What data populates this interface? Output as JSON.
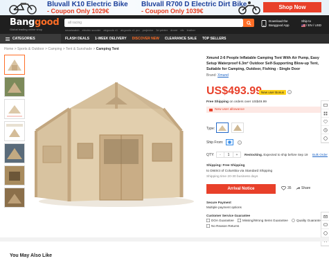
{
  "banner": {
    "left_title": "Bluvall K10 Electric Bike",
    "left_coupon": "- Coupon Only 1029€",
    "right_title": "Bluvall R700 D Electric Dirt Bike",
    "right_coupon": "- Coupon Only 1039€",
    "cta": "Shop Now"
  },
  "header": {
    "logo_main": "Bang",
    "logo_accent": "good",
    "tagline": "Global leading online shop",
    "search_value": "all racing",
    "hot_searches": [
      "smartwatch",
      "electric scooter",
      "airgoods x1",
      "airgoods x1 pro",
      "projector",
      "3d printer",
      "drone",
      "nfc",
      "leather"
    ],
    "app_line1": "Download the",
    "app_line2": "Banggood App",
    "ship_line1": "Ship to",
    "ship_line2": "/ EN / USD"
  },
  "nav": {
    "categories": "CATEGORIES",
    "items": [
      "FLASH DEALS",
      "1-WEEK DELIVERY",
      "DISCOVER NEW",
      "CLEARANCE SALE",
      "TOP SELLERS"
    ]
  },
  "breadcrumb": {
    "path": "Home > Sports & Outdoor > Camping > Tent & Sunshade > ",
    "current": "Camping Tent"
  },
  "product": {
    "title": "Xmund 2-6 People Inflatable Camping Tent With Air Pump, Easy Setup Waterproof 6.3m² Outdoor Self-Supporting Blow-up Tent, Suitable for Camping, Outdoor, Fishing - Single Door",
    "brand_label": "Brand: ",
    "brand": "Xmund",
    "price": "US$493.99",
    "bonus_badge": "New user Bonus",
    "free_ship_bold": "Free Shipping",
    "free_ship_rest": " on orders over US$49.99",
    "allowance": "New user allowance",
    "type_label": "Type:",
    "ship_from_label": "Ship From:",
    "qty_label": "QTY:",
    "qty_minus": "-",
    "qty_value": "1",
    "qty_plus": "+",
    "restock_bold": "Restocking.",
    "restock_rest": " Expected to ship before Sep 19",
    "bulk": "Bulk Order",
    "ship_title": "Shipping: Free Shipping",
    "ship_to": "to District of Columbia via Standard Shipping",
    "ship_time": "Shipping time 20-30 business days",
    "notice_btn": "Arrival Notice",
    "wish_count": "35",
    "share": "Share",
    "secure_title": "Secure Payment",
    "secure_sub": "Multiple payment options",
    "service_title": "Customer Service Guarantee",
    "guarantees": [
      "DOA Guarantee",
      "Missing/Wrong Items Guarantee",
      "Quality Guarantee"
    ],
    "no_return": "No Reason Returns"
  },
  "bottom": {
    "also_like": "You May Also Like"
  },
  "colors": {
    "brand_orange": "#ff6e26",
    "price_red": "#e8402a",
    "header_bg": "#1f1f1f",
    "link_blue": "#2167c7"
  }
}
